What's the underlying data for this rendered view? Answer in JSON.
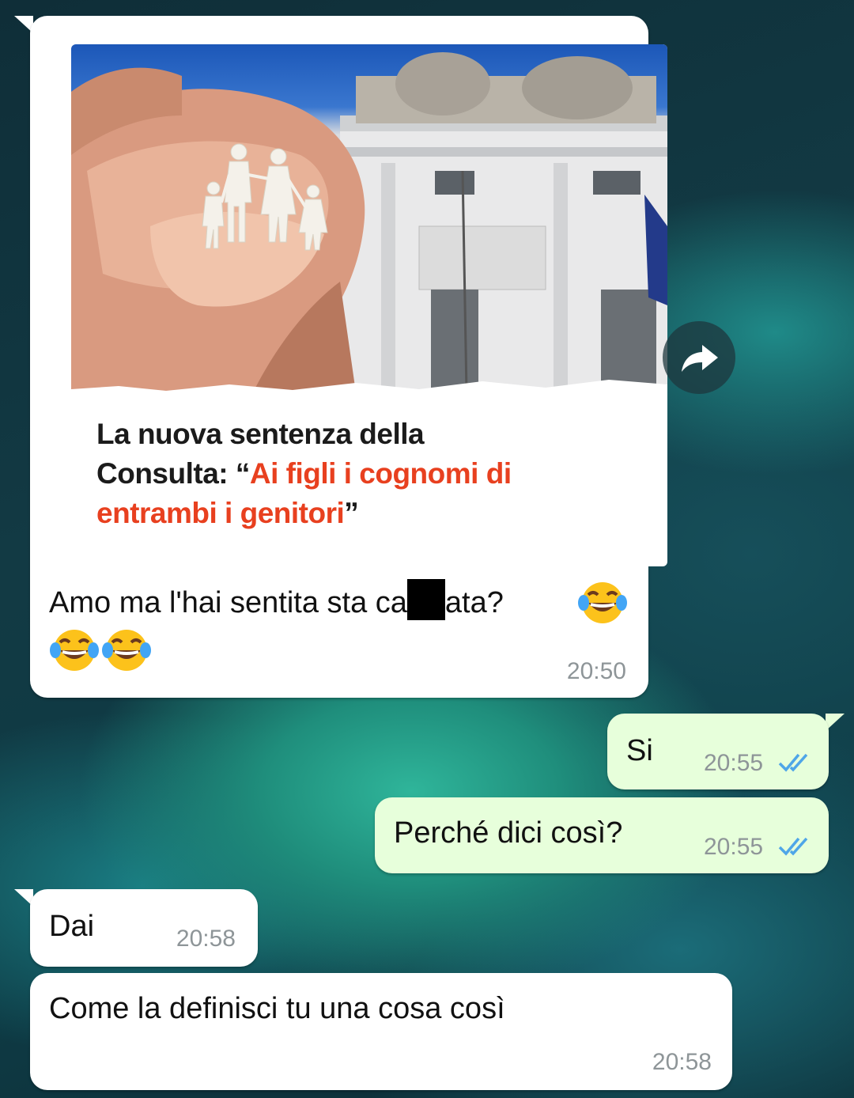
{
  "messages": [
    {
      "image_card": {
        "headline_black_1": "La nuova sentenza della",
        "headline_black_2": "Consulta: “",
        "headline_red_1": "Ai figli i cognomi di",
        "headline_red_2": "entrambi i genitori",
        "headline_close_quote": "”"
      },
      "text_before_redaction": "Amo ma l'hai sentita sta ca",
      "text_after_redaction": "ata?",
      "emoji_icon": "face-with-tears-of-joy-icon",
      "time": "20:50"
    },
    {
      "text": "Si",
      "time": "20:55",
      "status": "read"
    },
    {
      "text": "Perché dici così?",
      "time": "20:55",
      "status": "read"
    },
    {
      "text": "Dai",
      "time": "20:58"
    },
    {
      "text": "Come la definisci tu una cosa così",
      "time": "20:58"
    }
  ],
  "colors": {
    "incoming_bubble": "#ffffff",
    "outgoing_bubble": "#e7ffdb",
    "read_ticks": "#4fa6e8",
    "headline_red": "#e8401f"
  },
  "icons": {
    "forward": "forward-arrow-icon",
    "ticks": "double-check-icon"
  }
}
